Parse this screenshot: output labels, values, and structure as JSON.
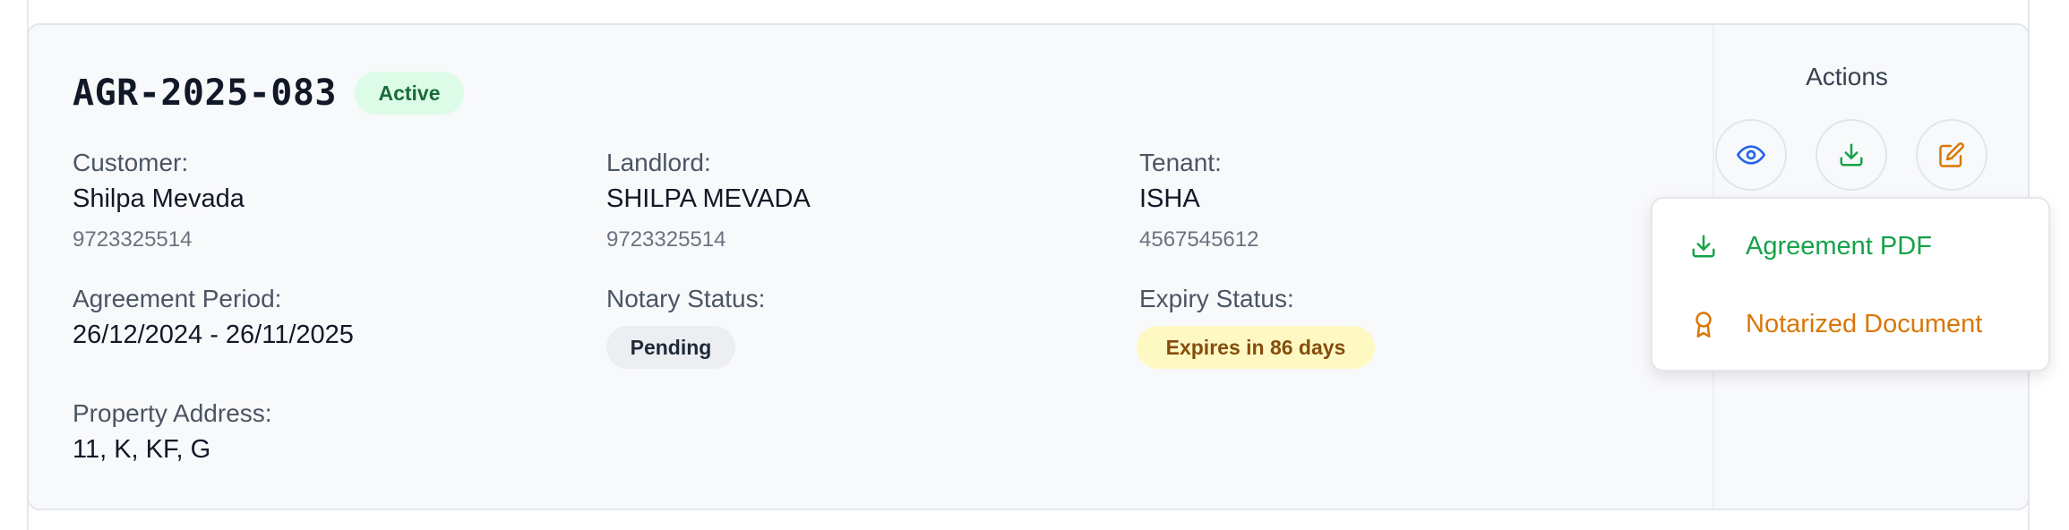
{
  "agreement": {
    "id": "AGR-2025-083",
    "status_badge": "Active",
    "customer": {
      "label": "Customer:",
      "name": "Shilpa Mevada",
      "phone": "9723325514"
    },
    "landlord": {
      "label": "Landlord:",
      "name": "SHILPA MEVADA",
      "phone": "9723325514"
    },
    "tenant": {
      "label": "Tenant:",
      "name": "ISHA",
      "phone": "4567545612"
    },
    "period": {
      "label": "Agreement Period:",
      "value": "26/12/2024 - 26/11/2025"
    },
    "notary": {
      "label": "Notary Status:",
      "value": "Pending"
    },
    "expiry": {
      "label": "Expiry Status:",
      "value": "Expires in 86 days"
    },
    "address": {
      "label": "Property Address:",
      "value": "11, K, KF, G"
    }
  },
  "actions": {
    "title": "Actions",
    "buttons": [
      {
        "icon": "eye-icon",
        "color": "#2563eb"
      },
      {
        "icon": "download-icon",
        "color": "#16a34a"
      },
      {
        "icon": "edit-icon",
        "color": "#d97706"
      }
    ],
    "dropdown": [
      {
        "icon": "download-icon",
        "label": "Agreement PDF",
        "color": "#16a34a"
      },
      {
        "icon": "award-icon",
        "label": "Notarized Document",
        "color": "#d97706"
      }
    ]
  },
  "colors": {
    "active_badge_bg": "#dcfce7",
    "active_badge_text": "#1a6b3a",
    "expiry_badge_bg": "#fef9c3",
    "expiry_badge_text": "#854d0e",
    "view": "#2563eb",
    "download": "#16a34a",
    "edit": "#d97706"
  }
}
